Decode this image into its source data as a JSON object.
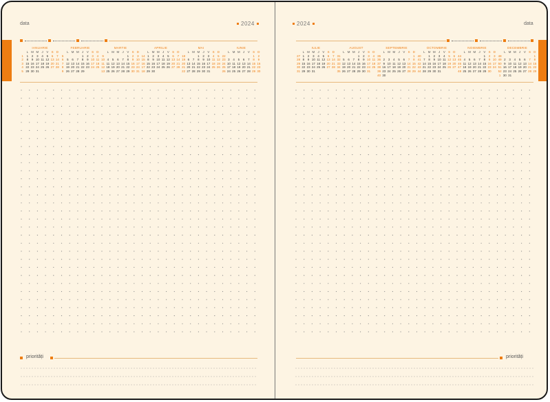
{
  "left_page": {
    "date_label": "data",
    "year": "2024",
    "priorities_label": "priorități"
  },
  "right_page": {
    "date_label": "data",
    "year": "2024",
    "priorities_label": "priorități"
  },
  "weekday_headers": [
    "",
    "L",
    "M",
    "M",
    "J",
    "V",
    "S",
    "D"
  ],
  "months_left": [
    {
      "name": "IANUARIE",
      "rows": [
        [
          "1",
          "1",
          "2",
          "3",
          "4",
          "5",
          "6",
          "7"
        ],
        [
          "2",
          "8",
          "9",
          "10",
          "11",
          "12",
          "13",
          "14"
        ],
        [
          "3",
          "15",
          "16",
          "17",
          "18",
          "19",
          "20",
          "21"
        ],
        [
          "4",
          "22",
          "23",
          "24",
          "25",
          "26",
          "27",
          "28"
        ],
        [
          "5",
          "29",
          "30",
          "31",
          "",
          "",
          "",
          ""
        ]
      ]
    },
    {
      "name": "FEBRUARIE",
      "rows": [
        [
          "5",
          "",
          "",
          "",
          "1",
          "2",
          "3",
          "4"
        ],
        [
          "6",
          "5",
          "6",
          "7",
          "8",
          "9",
          "10",
          "11"
        ],
        [
          "7",
          "12",
          "13",
          "14",
          "15",
          "16",
          "17",
          "18"
        ],
        [
          "8",
          "19",
          "20",
          "21",
          "22",
          "23",
          "24",
          "25"
        ],
        [
          "9",
          "26",
          "27",
          "28",
          "29",
          "",
          "",
          ""
        ]
      ]
    },
    {
      "name": "MARTIE",
      "rows": [
        [
          "9",
          "",
          "",
          "",
          "",
          "1",
          "2",
          "3"
        ],
        [
          "10",
          "4",
          "5",
          "6",
          "7",
          "8",
          "9",
          "10"
        ],
        [
          "11",
          "11",
          "12",
          "13",
          "14",
          "15",
          "16",
          "17"
        ],
        [
          "12",
          "18",
          "19",
          "20",
          "21",
          "22",
          "23",
          "24"
        ],
        [
          "13",
          "25",
          "26",
          "27",
          "28",
          "29",
          "30",
          "31"
        ]
      ]
    },
    {
      "name": "APRILIE",
      "rows": [
        [
          "14",
          "1",
          "2",
          "3",
          "4",
          "5",
          "6",
          "7"
        ],
        [
          "15",
          "8",
          "9",
          "10",
          "11",
          "12",
          "13",
          "14"
        ],
        [
          "16",
          "15",
          "16",
          "17",
          "18",
          "19",
          "20",
          "21"
        ],
        [
          "17",
          "22",
          "23",
          "24",
          "25",
          "26",
          "27",
          "28"
        ],
        [
          "18",
          "29",
          "30",
          "",
          "",
          "",
          "",
          ""
        ]
      ]
    },
    {
      "name": "MAI",
      "rows": [
        [
          "18",
          "",
          "",
          "1",
          "2",
          "3",
          "4",
          "5"
        ],
        [
          "19",
          "6",
          "7",
          "8",
          "9",
          "10",
          "11",
          "12"
        ],
        [
          "20",
          "13",
          "14",
          "15",
          "16",
          "17",
          "18",
          "19"
        ],
        [
          "21",
          "20",
          "21",
          "22",
          "23",
          "24",
          "25",
          "26"
        ],
        [
          "22",
          "27",
          "28",
          "29",
          "30",
          "31",
          "",
          ""
        ]
      ]
    },
    {
      "name": "IUNIE",
      "rows": [
        [
          "22",
          "",
          "",
          "",
          "",
          "",
          "1",
          "2"
        ],
        [
          "23",
          "3",
          "4",
          "5",
          "6",
          "7",
          "8",
          "9"
        ],
        [
          "24",
          "10",
          "11",
          "12",
          "13",
          "14",
          "15",
          "16"
        ],
        [
          "25",
          "17",
          "18",
          "19",
          "20",
          "21",
          "22",
          "23"
        ],
        [
          "26",
          "24",
          "25",
          "26",
          "27",
          "28",
          "29",
          "30"
        ]
      ]
    }
  ],
  "months_right": [
    {
      "name": "IULIE",
      "rows": [
        [
          "27",
          "1",
          "2",
          "3",
          "4",
          "5",
          "6",
          "7"
        ],
        [
          "28",
          "8",
          "9",
          "10",
          "11",
          "12",
          "13",
          "14"
        ],
        [
          "29",
          "15",
          "16",
          "17",
          "18",
          "19",
          "20",
          "21"
        ],
        [
          "30",
          "22",
          "23",
          "24",
          "25",
          "26",
          "27",
          "28"
        ],
        [
          "31",
          "29",
          "30",
          "31",
          "",
          "",
          "",
          ""
        ]
      ]
    },
    {
      "name": "AUGUST",
      "rows": [
        [
          "31",
          "",
          "",
          "",
          "1",
          "2",
          "3",
          "4"
        ],
        [
          "32",
          "5",
          "6",
          "7",
          "8",
          "9",
          "10",
          "11"
        ],
        [
          "33",
          "12",
          "13",
          "14",
          "15",
          "16",
          "17",
          "18"
        ],
        [
          "34",
          "19",
          "20",
          "21",
          "22",
          "23",
          "24",
          "25"
        ],
        [
          "35",
          "26",
          "27",
          "28",
          "29",
          "30",
          "31",
          ""
        ]
      ]
    },
    {
      "name": "SEPTEMBRIE",
      "rows": [
        [
          "35",
          "",
          "",
          "",
          "",
          "",
          "",
          "1"
        ],
        [
          "36",
          "2",
          "3",
          "4",
          "5",
          "6",
          "7",
          "8"
        ],
        [
          "37",
          "9",
          "10",
          "11",
          "12",
          "13",
          "14",
          "15"
        ],
        [
          "38",
          "16",
          "17",
          "18",
          "19",
          "20",
          "21",
          "22"
        ],
        [
          "39",
          "23",
          "24",
          "25",
          "26",
          "27",
          "28",
          "29"
        ],
        [
          "40",
          "30",
          "",
          "",
          "",
          "",
          "",
          ""
        ]
      ]
    },
    {
      "name": "OCTOMBRIE",
      "rows": [
        [
          "40",
          "",
          "1",
          "2",
          "3",
          "4",
          "5",
          "6"
        ],
        [
          "41",
          "7",
          "8",
          "9",
          "10",
          "11",
          "12",
          "13"
        ],
        [
          "42",
          "14",
          "15",
          "16",
          "17",
          "18",
          "19",
          "20"
        ],
        [
          "43",
          "21",
          "22",
          "23",
          "24",
          "25",
          "26",
          "27"
        ],
        [
          "44",
          "28",
          "29",
          "30",
          "31",
          "",
          "",
          ""
        ]
      ]
    },
    {
      "name": "NOIEMBRIE",
      "rows": [
        [
          "44",
          "",
          "",
          "",
          "",
          "1",
          "2",
          "3"
        ],
        [
          "45",
          "4",
          "5",
          "6",
          "7",
          "8",
          "9",
          "10"
        ],
        [
          "46",
          "11",
          "12",
          "13",
          "14",
          "15",
          "16",
          "17"
        ],
        [
          "47",
          "18",
          "19",
          "20",
          "21",
          "22",
          "23",
          "24"
        ],
        [
          "48",
          "25",
          "26",
          "27",
          "28",
          "29",
          "30",
          ""
        ]
      ]
    },
    {
      "name": "DECEMBRIE",
      "rows": [
        [
          "48",
          "",
          "",
          "",
          "",
          "",
          "",
          "1"
        ],
        [
          "49",
          "2",
          "3",
          "4",
          "5",
          "6",
          "7",
          "8"
        ],
        [
          "50",
          "9",
          "10",
          "11",
          "12",
          "13",
          "14",
          "15"
        ],
        [
          "51",
          "16",
          "17",
          "18",
          "19",
          "20",
          "21",
          "22"
        ],
        [
          "52",
          "23",
          "24",
          "25",
          "26",
          "27",
          "28",
          "29"
        ],
        [
          "1",
          "30",
          "31",
          "",
          "",
          "",
          "",
          ""
        ]
      ]
    }
  ],
  "colors": {
    "accent": "#ee7d12",
    "paper": "#fdf4e3",
    "border": "#1a1a1a"
  }
}
